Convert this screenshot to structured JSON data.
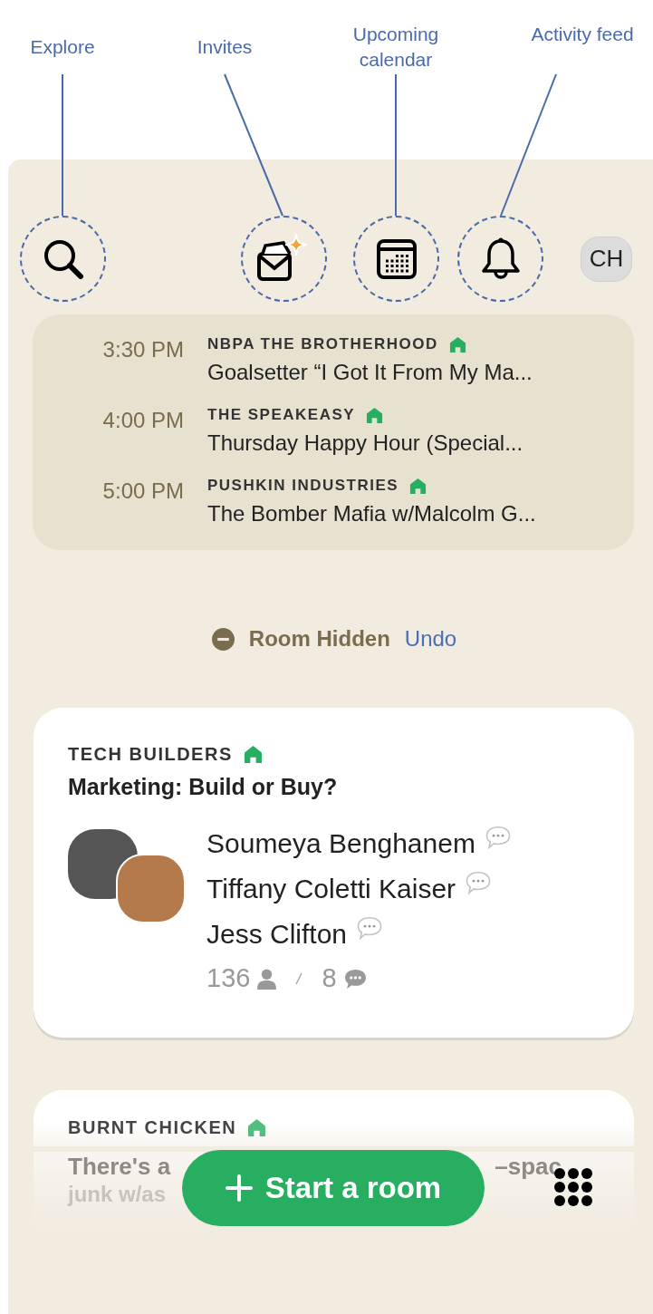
{
  "annotations": [
    {
      "label": "Explore"
    },
    {
      "label": "Invites"
    },
    {
      "label": "Upcoming calendar"
    },
    {
      "label": "Activity feed"
    }
  ],
  "header": {
    "avatar_initials": "CH"
  },
  "upcoming": [
    {
      "time": "3:30 PM",
      "club": "NBPA THE BROTHERHOOD",
      "title": "Goalsetter “I Got It From My Ma..."
    },
    {
      "time": "4:00 PM",
      "club": "THE SPEAKEASY",
      "title": "Thursday Happy Hour (Special..."
    },
    {
      "time": "5:00 PM",
      "club": "PUSHKIN INDUSTRIES",
      "title": "The Bomber Mafia w/Malcolm G..."
    }
  ],
  "hidden_notice": {
    "text": "Room Hidden",
    "action": "Undo"
  },
  "rooms": [
    {
      "club": "TECH BUILDERS",
      "title": "Marketing: Build or Buy?",
      "speakers": [
        {
          "name": "Soumeya Benghanem"
        },
        {
          "name": "Tiffany Coletti Kaiser"
        },
        {
          "name": "Jess Clifton"
        }
      ],
      "listeners": "136",
      "speaking_count": "8"
    }
  ],
  "partial_room": {
    "club": "BURNT CHICKEN",
    "title_fragments": [
      "There's a",
      "–spac",
      "junk w/as"
    ]
  },
  "start_room_button": {
    "label": "Start a room"
  }
}
